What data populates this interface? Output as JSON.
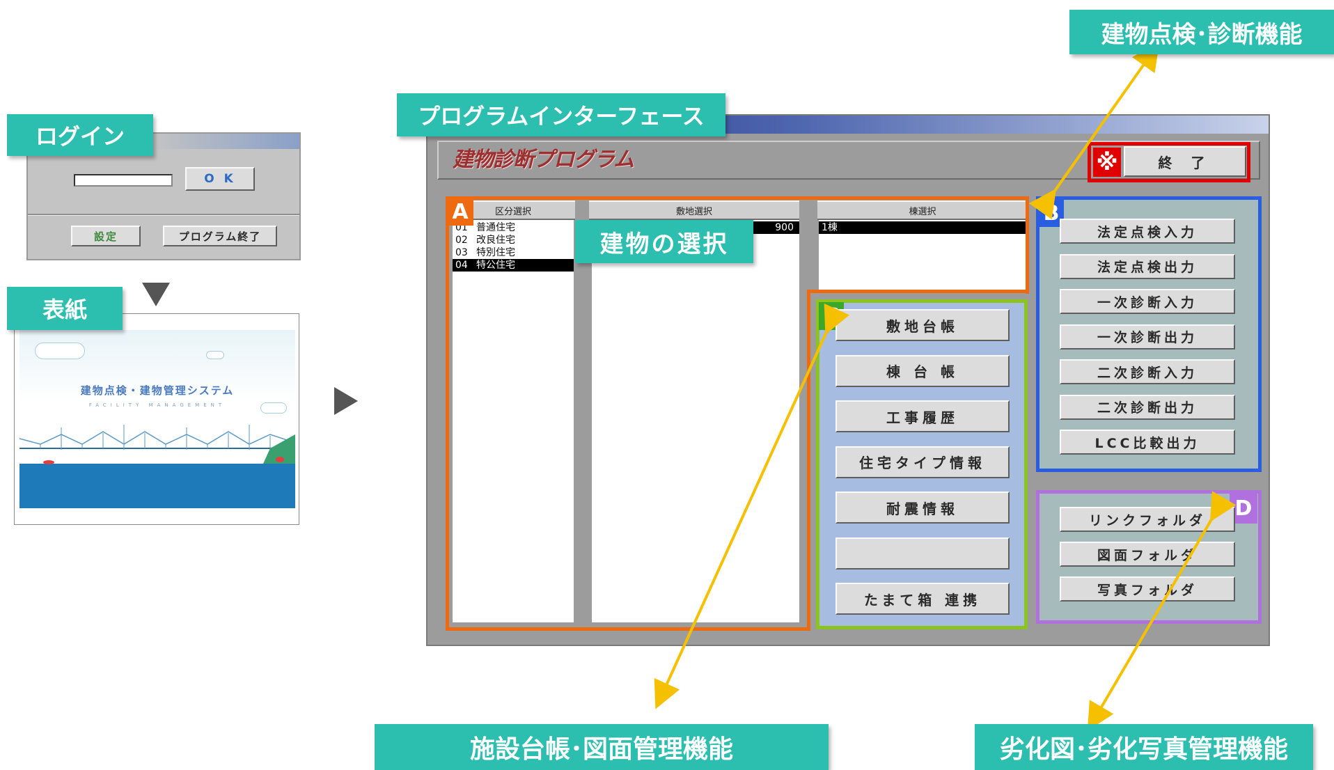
{
  "colors": {
    "teal": "#2cbfb0",
    "orange": "#ee6a10",
    "blue": "#2a5ee0",
    "green": "#8bc41e",
    "purple": "#b070dd",
    "red": "#e00000",
    "arrow": "#f5c000"
  },
  "labels": {
    "login": "ログイン",
    "cover": "表紙",
    "interface": "プログラムインターフェース",
    "building_selection": "建物の選択",
    "inspection_function": "建物点検･診断機能",
    "ledger_function": "施設台帳･図面管理機能",
    "degradation_function": "劣化図･劣化写真管理機能"
  },
  "login_dialog": {
    "ok_label": "O K",
    "settings_label": "設定",
    "exit_label": "プログラム終了"
  },
  "cover": {
    "title": "建物点検・建物管理システム",
    "subtitle": "FACILITY MANAGEMENT"
  },
  "program": {
    "title": "建物診断プログラム",
    "exit_label": "終 了",
    "exit_mark": "※",
    "columns": {
      "kubun": "区分選択",
      "site": "敷地選択",
      "bldg": "棟選択"
    },
    "kubun_rows": [
      {
        "code": "01",
        "name": "普通住宅",
        "selected": false
      },
      {
        "code": "02",
        "name": "改良住宅",
        "selected": false
      },
      {
        "code": "03",
        "name": "特別住宅",
        "selected": false
      },
      {
        "code": "04",
        "name": "特公住宅",
        "selected": true
      }
    ],
    "site_row": "900",
    "bldg_row": "1棟",
    "section_letters": {
      "a": "A",
      "b": "B",
      "c": "C",
      "d": "D"
    },
    "b_buttons": [
      "法定点検入力",
      "法定点検出力",
      "一次診断入力",
      "一次診断出力",
      "二次診断入力",
      "二次診断出力",
      "LCC比較出力"
    ],
    "c_buttons": [
      "敷地台帳",
      "棟 台 帳",
      "工事履歴",
      "住宅タイプ情報",
      "耐震情報",
      "",
      "たまて箱 連携"
    ],
    "d_buttons": [
      "リンクフォルダ",
      "図面フォルダ",
      "写真フォルダ"
    ]
  }
}
